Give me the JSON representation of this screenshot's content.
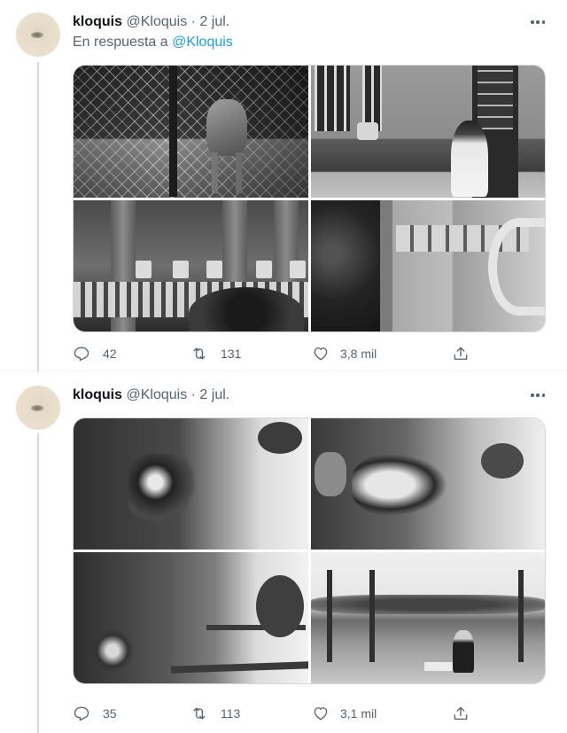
{
  "tweets": [
    {
      "name": "kloquis",
      "handle": "@Kloquis",
      "separator": "·",
      "date": "2 jul.",
      "reply_prefix": "En respuesta a",
      "reply_handle": "@Kloquis",
      "stats": {
        "replies": "42",
        "retweets": "131",
        "likes": "3,8 mil"
      }
    },
    {
      "name": "kloquis",
      "handle": "@Kloquis",
      "separator": "·",
      "date": "2 jul.",
      "stats": {
        "replies": "35",
        "retweets": "113",
        "likes": "3,1 mil"
      }
    }
  ],
  "icons": {
    "more": "more-dots-icon",
    "reply": "reply-icon",
    "retweet": "retweet-icon",
    "like": "heart-icon",
    "share": "share-icon"
  },
  "colors": {
    "text": "#0f1419",
    "secondary": "#536471",
    "link": "#1d9bf0",
    "thread_line": "#cfd9de"
  }
}
